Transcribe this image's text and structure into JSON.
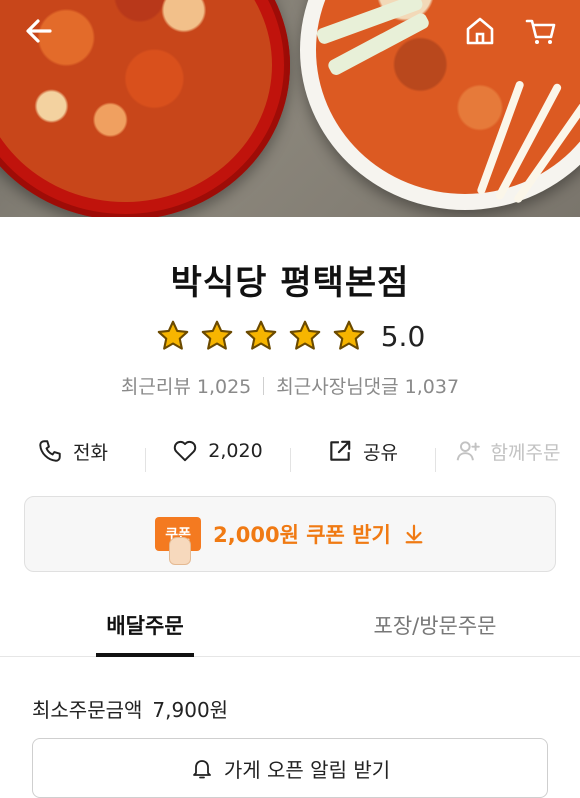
{
  "header": {
    "back_icon": "arrow-left-icon",
    "home_icon": "home-icon",
    "cart_icon": "cart-icon"
  },
  "store": {
    "name": "박식당 평택본점",
    "rating": "5.0",
    "stars": 5,
    "star_color": "#f7b500",
    "recent_reviews": "최근리뷰 1,025",
    "owner_replies": "최근사장님댓글 1,037"
  },
  "actions": {
    "call": "전화",
    "likes": "2,020",
    "share": "공유",
    "group_order": "함께주문"
  },
  "coupon": {
    "badge": "쿠폰",
    "text": "2,000원 쿠폰 받기",
    "accent": "#f07a13"
  },
  "tabs": {
    "delivery": "배달주문",
    "pickup": "포장/방문주문"
  },
  "order": {
    "min_label": "최소주문금액",
    "min_value": "7,900원",
    "open_alert": "가게 오픈 알림 받기"
  }
}
